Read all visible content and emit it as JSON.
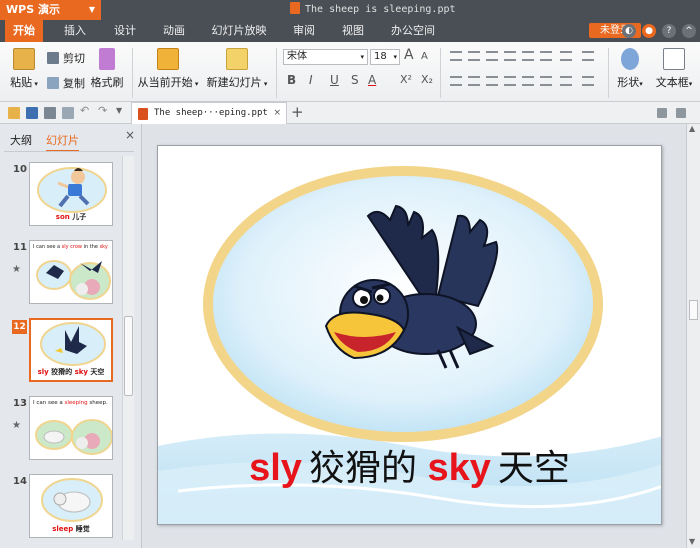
{
  "app": {
    "name": "WPS 演示",
    "doc_title": "The sheep is sleeping.ppt"
  },
  "menu": {
    "tabs": [
      "开始",
      "插入",
      "设计",
      "动画",
      "幻灯片放映",
      "审阅",
      "视图",
      "办公空间"
    ],
    "login": "未登录"
  },
  "ribbon": {
    "paste": "粘贴",
    "cut": "剪切",
    "copy": "复制",
    "format_painter": "格式刷",
    "play_from_current": "从当前开始",
    "new_slide": "新建幻灯片",
    "font_name": "宋体",
    "font_size": "18",
    "shape": "形状",
    "textbox": "文本框"
  },
  "doc_tab": {
    "label": "The sheep···eping.ppt"
  },
  "panel": {
    "tabs": [
      "大纲",
      "幻灯片"
    ],
    "slides": [
      {
        "num": "10",
        "caption_en": "son",
        "caption_zh": "儿子"
      },
      {
        "num": "11",
        "text_a": "I can see a ",
        "text_b": "sly crow",
        "text_c": " in the ",
        "text_d": "sky"
      },
      {
        "num": "12",
        "caption_a": "sly",
        "caption_b": "狡猾的",
        "caption_c": "sky",
        "caption_d": "天空"
      },
      {
        "num": "13",
        "text_a": "I can see a ",
        "text_b": "sleeping",
        "text_c": " sheep."
      },
      {
        "num": "14",
        "caption_en": "sleep",
        "caption_zh": "睡觉"
      }
    ]
  },
  "slide": {
    "word1_en": "sly",
    "word1_zh": "狡猾的",
    "word2_en": "sky",
    "word2_zh": "天空"
  },
  "colors": {
    "accent": "#e8691f",
    "title_bg": "#4a4f55",
    "caption_red": "#e8141c"
  }
}
